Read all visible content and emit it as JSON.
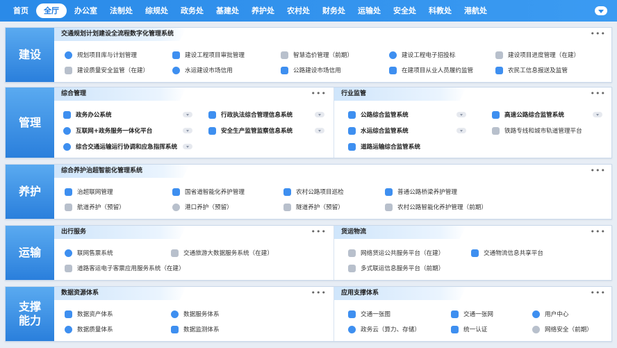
{
  "nav": [
    "首页",
    "全厅",
    "办公室",
    "法制处",
    "综规处",
    "政务处",
    "基建处",
    "养护处",
    "农村处",
    "财务处",
    "运输处",
    "安全处",
    "科教处",
    "港航处"
  ],
  "rows": [
    {
      "label": "建设",
      "panels": [
        {
          "title": "交通规划计划建设全流程数字化管理系统",
          "items": [
            "规划项目库与计划管理",
            "建设工程项目审批管理",
            "智慧造价管理（前期）",
            "建设工程电子招投标",
            "建设项目进度管理（在建）",
            "建设质量安全监管（在建）",
            "水运建设市场信用",
            "公路建设市场信用",
            "在建项目从业人员履约监管",
            "农民工信息报送及监管"
          ]
        }
      ]
    },
    {
      "label": "管理",
      "panels": [
        {
          "title": "综合管理",
          "items": [
            "政务办公系统",
            "行政执法综合管理信息系统",
            "互联网+政务服务一体化平台",
            "安全生产监管监察信息系统",
            "综合交通运输运行协调和应急指挥系统"
          ]
        },
        {
          "title": "行业监管",
          "items": [
            "公路综合监管系统",
            "高速公路综合监管系统",
            "水运综合监管系统",
            "铁路专线和城市轨道管理平台",
            "道路运输综合监管系统"
          ]
        }
      ]
    },
    {
      "label": "养护",
      "panels": [
        {
          "title": "综合养护治超智能化管理系统",
          "items": [
            "治超联网管理",
            "国省道智能化养护管理",
            "农村公路项目巡检",
            "普通公路桥梁养护管理",
            "航道养护（预留）",
            "港口养护（预留）",
            "隧道养护（预留）",
            "农村公路智能化养护管理（前期）"
          ]
        }
      ]
    },
    {
      "label": "运输",
      "panels": [
        {
          "title": "出行服务",
          "items": [
            "联网售票系统",
            "交通旅游大数据服务系统（在建）",
            "道路客运电子客票应用服务系统（在建）"
          ]
        },
        {
          "title": "货运物流",
          "items": [
            "网络货运公共服务平台（在建）",
            "交通物流信息共享平台",
            "多式联运信息服务平台（前期）"
          ]
        }
      ]
    },
    {
      "label": "支撑\n能力",
      "panels": [
        {
          "title": "数据资源体系",
          "items": [
            "数据资产体系",
            "数据服务体系",
            "数据质量体系",
            "数据监测体系"
          ]
        },
        {
          "title": "应用支撑体系",
          "items": [
            "交通一张图",
            "交通一张网",
            "用户中心",
            "政务云（算力、存储）",
            "统一认证",
            "网络安全（前期）"
          ]
        }
      ]
    }
  ],
  "more_symbol": "•••"
}
